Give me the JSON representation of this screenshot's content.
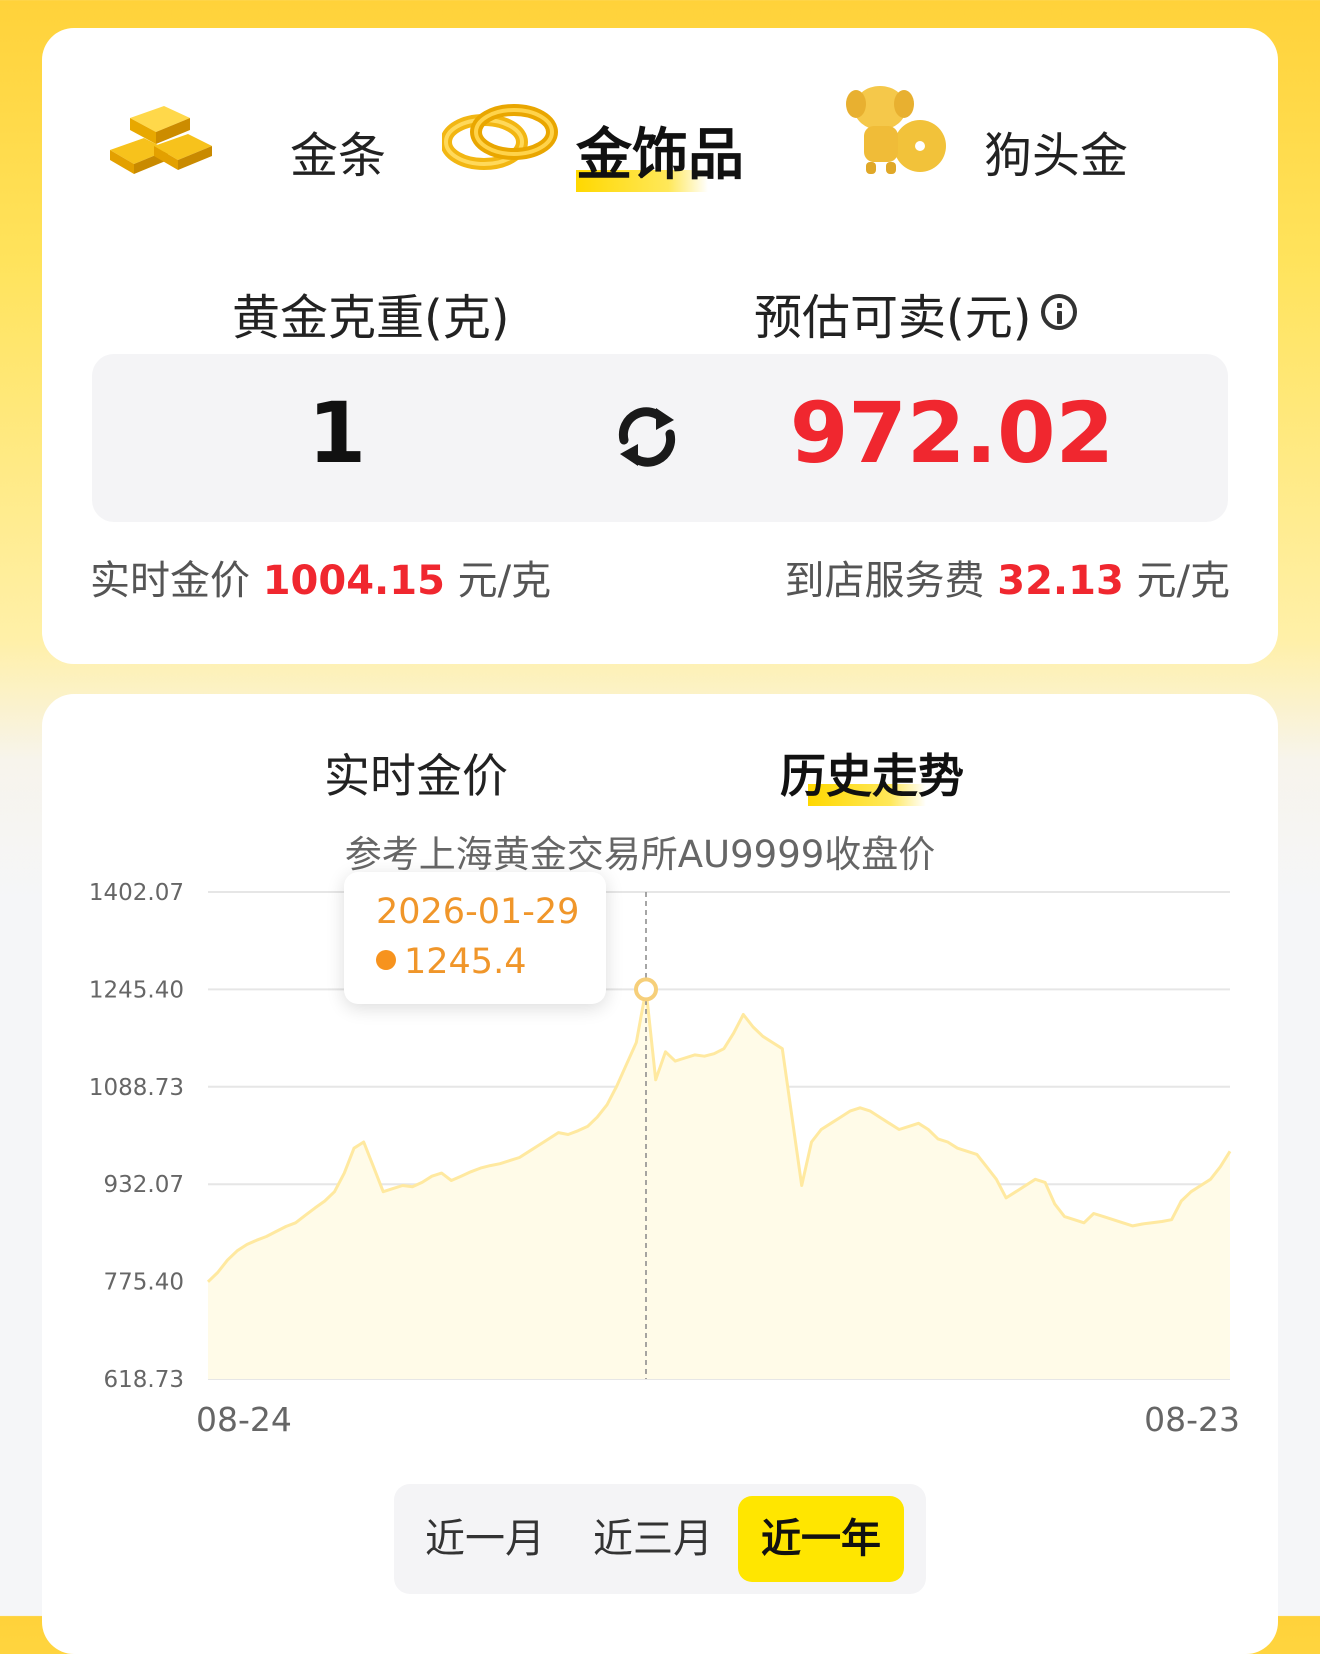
{
  "product_tabs": [
    {
      "label": "金条",
      "active": false
    },
    {
      "label": "金饰品",
      "active": true
    },
    {
      "label": "狗头金",
      "active": false
    }
  ],
  "calculator": {
    "weight_label": "黄金克重(克)",
    "estimate_label": "预估可卖(元)",
    "weight_value": "1",
    "estimate_value": "972.02"
  },
  "realtime_price": {
    "label": "实时金价",
    "value": "1004.15",
    "unit": "元/克"
  },
  "service_fee": {
    "label": "到店服务费",
    "value": "32.13",
    "unit": "元/克"
  },
  "chart_tabs": [
    {
      "label": "实时金价",
      "active": false
    },
    {
      "label": "历史走势",
      "active": true
    }
  ],
  "chart_subtitle": "参考上海黄金交易所AU9999收盘价",
  "tooltip": {
    "date": "2026-01-29",
    "value": "1245.4"
  },
  "range_buttons": [
    {
      "label": "近一月",
      "active": false
    },
    {
      "label": "近三月",
      "active": false
    },
    {
      "label": "近一年",
      "active": true
    }
  ],
  "colors": {
    "accent_yellow": "#ffe600",
    "price_red": "#f0272f",
    "line_color": "#ffe9a0",
    "tooltip_orange": "#f0962a"
  },
  "chart_data": {
    "type": "area",
    "y_ticks": [
      "1402.07",
      "1245.40",
      "1088.73",
      "932.07",
      "775.40",
      "618.73"
    ],
    "ylim": [
      618.73,
      1402.07
    ],
    "x_tick_labels": [
      "08-24",
      "08-23"
    ],
    "grid": true,
    "highlight": {
      "x": "2026-01-29",
      "y": 1245.4
    },
    "values": [
      775,
      790,
      810,
      825,
      835,
      842,
      848,
      856,
      864,
      870,
      882,
      894,
      905,
      920,
      950,
      990,
      1000,
      960,
      920,
      925,
      930,
      928,
      935,
      945,
      950,
      938,
      945,
      952,
      958,
      962,
      965,
      970,
      975,
      985,
      995,
      1005,
      1015,
      1012,
      1018,
      1025,
      1040,
      1060,
      1090,
      1125,
      1160,
      1245.4,
      1100,
      1145,
      1130,
      1135,
      1140,
      1138,
      1142,
      1150,
      1175,
      1205,
      1185,
      1170,
      1160,
      1150,
      1040,
      930,
      1000,
      1020,
      1030,
      1040,
      1050,
      1055,
      1050,
      1040,
      1030,
      1020,
      1025,
      1030,
      1020,
      1005,
      1000,
      990,
      985,
      980,
      960,
      940,
      910,
      920,
      930,
      940,
      935,
      900,
      880,
      875,
      870,
      885,
      880,
      875,
      870,
      865,
      868,
      870,
      872,
      875,
      905,
      920,
      930,
      940,
      960,
      985
    ]
  }
}
